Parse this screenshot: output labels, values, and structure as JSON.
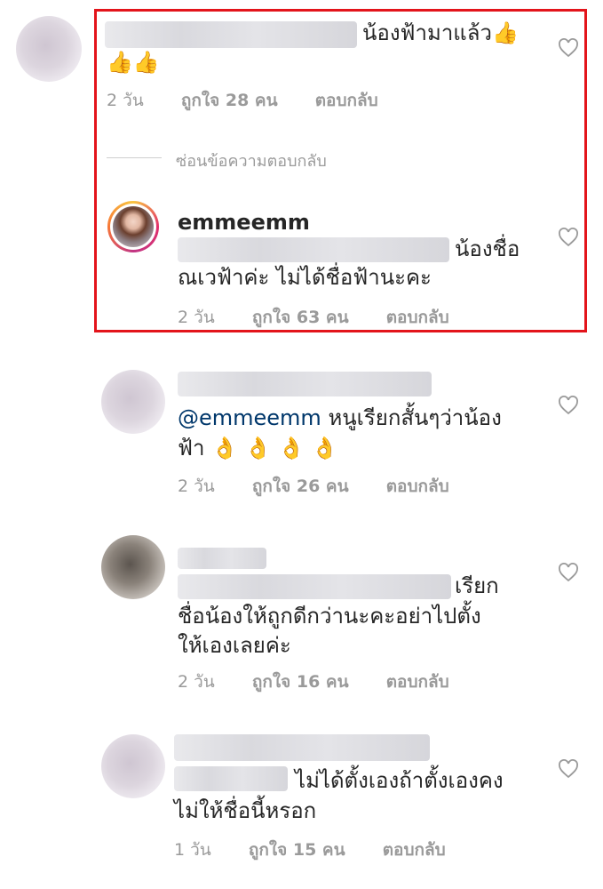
{
  "comments": [
    {
      "text_line1": "น้องฟ้ามาแล้ว",
      "text_line2": "",
      "time": "2 วัน",
      "likes": "ถูกใจ 28 คน",
      "reply": "ตอบกลับ"
    },
    {
      "username": "emmeemm",
      "text_line1": "น้องชื่อ",
      "text_line2": "ณเวฟ้าค่ะ ไม่ได้ชื่อฟ้านะคะ",
      "time": "2 วัน",
      "likes": "ถูกใจ 63 คน",
      "reply": "ตอบกลับ"
    },
    {
      "mention": "@emmeemm",
      "text_line1": "หนูเรียกสั้นๆว่าน้อง",
      "text_line2": "ฟ้า",
      "time": "2 วัน",
      "likes": "ถูกใจ 26 คน",
      "reply": "ตอบกลับ"
    },
    {
      "text_line1": "เรียก",
      "text_line2": "ชื่อน้องให้ถูกดีกว่านะคะอย่าไปตั้ง",
      "text_line3": "ให้เองเลยค่ะ",
      "time": "2 วัน",
      "likes": "ถูกใจ 16 คน",
      "reply": "ตอบกลับ"
    },
    {
      "text_line1": "ไม่ได้ตั้งเองถ้าตั้งเองคง",
      "text_line2": "ไม่ให้ชื่อนี้หรอก",
      "time": "1 วัน",
      "likes": "ถูกใจ 15 คน",
      "reply": "ตอบกลับ"
    }
  ],
  "hide_replies": "ซ่อนข้อความตอบกลับ",
  "icons": {
    "heart": "heart-outline-icon",
    "thumbs_up": "👍",
    "ok_hand": "👌"
  },
  "colors": {
    "highlight_border": "#e3141b",
    "meta_text": "#9a9a9a",
    "mention": "#00376b"
  }
}
